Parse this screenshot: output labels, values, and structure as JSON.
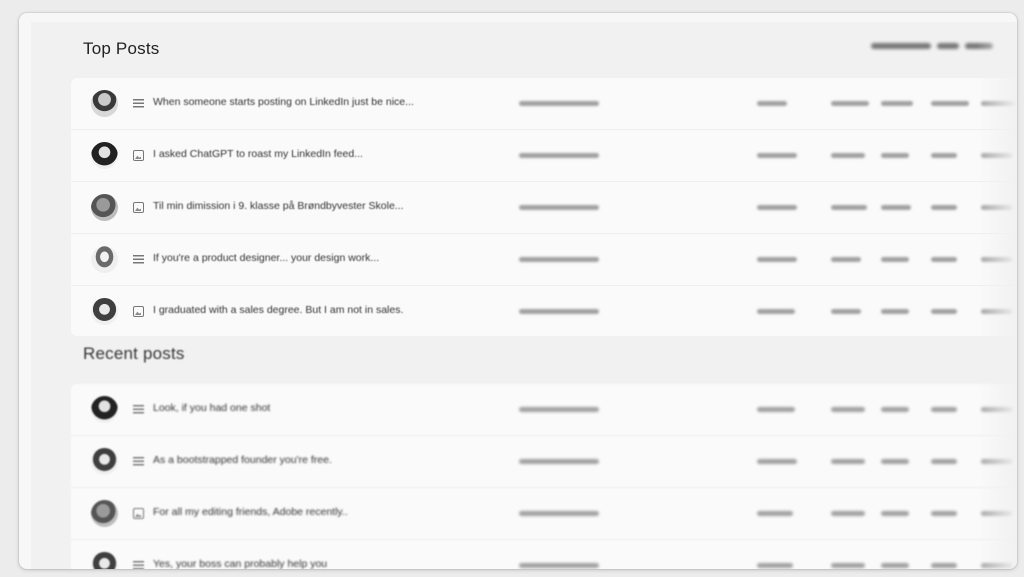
{
  "sections": {
    "top_posts_title": "Top Posts",
    "recent_posts_title": "Recent posts"
  },
  "top_posts": [
    {
      "title": "When someone starts posting on LinkedIn just be nice...",
      "post_type": "text",
      "avatar": "person-glasses"
    },
    {
      "title": "I asked ChatGPT to roast my LinkedIn feed...",
      "post_type": "image",
      "avatar": "person-long-hair"
    },
    {
      "title": "Til min dimission i 9. klasse på Brøndbyvester Skole...",
      "post_type": "image",
      "avatar": "person-outdoor"
    },
    {
      "title": "If you're a product designer... your design work...",
      "post_type": "text",
      "avatar": "person-long-hair"
    },
    {
      "title": "I graduated with a sales degree. But I am not in sales.",
      "post_type": "image",
      "avatar": "person-long-hair"
    }
  ],
  "recent_posts": [
    {
      "title": "Look, if you had one shot",
      "post_type": "text",
      "avatar": "person-long-hair"
    },
    {
      "title": "As a bootstrapped founder you're free.",
      "post_type": "text",
      "avatar": "person-short-hair"
    },
    {
      "title": "For all my editing friends, Adobe recently..",
      "post_type": "image",
      "avatar": "person-outdoor"
    },
    {
      "title": "Yes, your boss can probably help you",
      "post_type": "text",
      "avatar": "person-short-hair"
    }
  ],
  "colors": {
    "page_background": "#ececec",
    "panel_background": "#fafafa",
    "text": "#222222"
  }
}
